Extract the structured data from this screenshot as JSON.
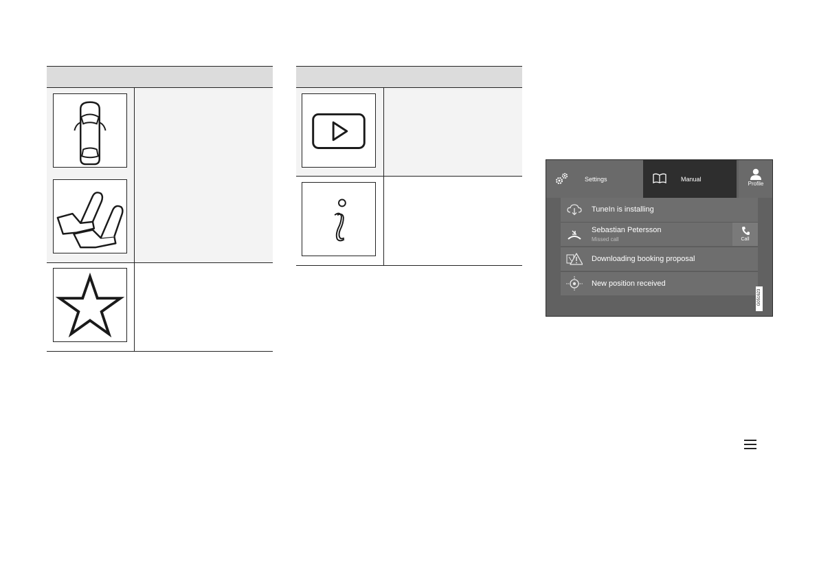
{
  "left_table": {
    "header": "",
    "rows": [
      {
        "icons": [
          "car-doors-icon",
          "seats-icon"
        ],
        "description": ""
      },
      {
        "icons": [
          "star-icon"
        ],
        "description": ""
      }
    ]
  },
  "middle_table": {
    "header": "",
    "rows": [
      {
        "icons": [
          "play-icon"
        ],
        "description": ""
      },
      {
        "icons": [
          "info-icon"
        ],
        "description": ""
      }
    ]
  },
  "screen": {
    "settings_label": "Settings",
    "manual_label": "Manual",
    "profile_label": "Profile",
    "notifications": [
      {
        "icon": "cloud-download-icon",
        "title": "TuneIn is installing"
      },
      {
        "icon": "missed-call-icon",
        "title": "Sebastian Petersson",
        "subtitle": "Missed call",
        "action_label": "Call"
      },
      {
        "icon": "warning-triangle-icon",
        "title": "Downloading booking proposal"
      },
      {
        "icon": "position-icon",
        "title": "New position received"
      }
    ],
    "image_code": "G051623",
    "colors": {
      "background": "#616161",
      "active_tab": "#2e2e2e",
      "panel": "#6e6e6e"
    }
  },
  "menu_icon": "hamburger-menu-icon"
}
